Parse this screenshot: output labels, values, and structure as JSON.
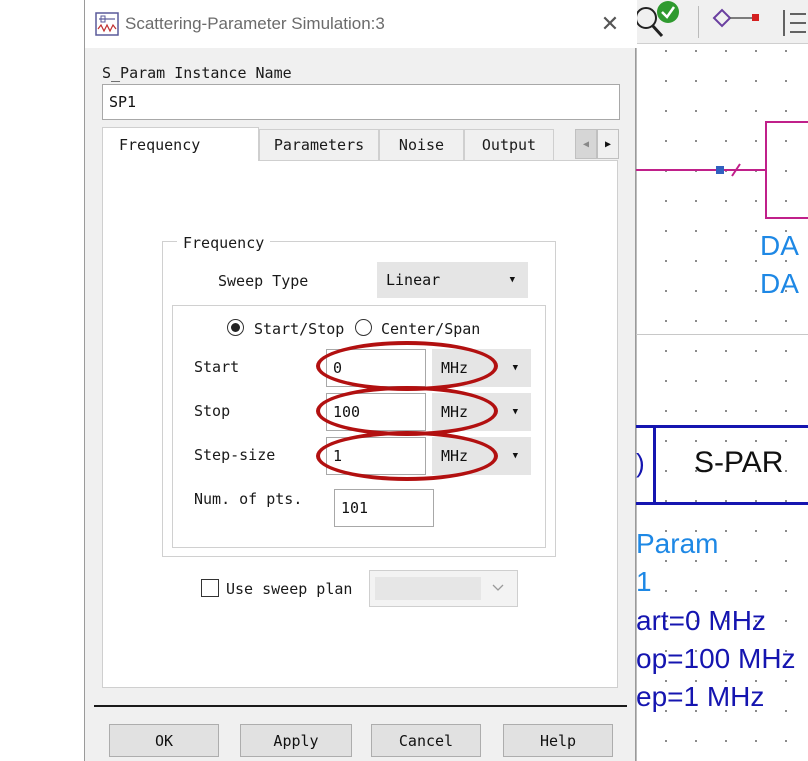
{
  "dialog": {
    "title": "Scattering-Parameter Simulation:3",
    "instance_label": "S_Param Instance Name",
    "instance_value": "SP1",
    "tabs": [
      "Frequency",
      "Parameters",
      "Noise",
      "Output"
    ],
    "active_tab": "Frequency",
    "group_title": "Frequency",
    "sweep_type_label": "Sweep Type",
    "sweep_type_value": "Linear",
    "radio_start_stop": "Start/Stop",
    "radio_center_span": "Center/Span",
    "selected_radio": "Start/Stop",
    "start_label": "Start",
    "start_value": "0",
    "start_unit": "MHz",
    "stop_label": "Stop",
    "stop_value": "100",
    "stop_unit": "MHz",
    "step_label": "Step-size",
    "step_value": "1",
    "step_unit": "MHz",
    "npts_label": "Num. of pts.",
    "npts_value": "101",
    "use_sweep_plan_label": "Use sweep plan",
    "use_sweep_plan_checked": false,
    "buttons": {
      "ok": "OK",
      "apply": "Apply",
      "cancel": "Cancel",
      "help": "Help"
    }
  },
  "schematic": {
    "labels_blue": [
      "DA",
      "DA"
    ],
    "block_title": "S-PAR",
    "param_lines": [
      "Param",
      "1",
      "art=0 MHz",
      "op=100 MHz",
      "ep=1 MHz"
    ]
  },
  "colors": {
    "annotation_red": "#b21010",
    "schematic_wire": "#c0208a",
    "schematic_text_blue": "#1e88e5",
    "schematic_block_blue": "#1515b0"
  }
}
